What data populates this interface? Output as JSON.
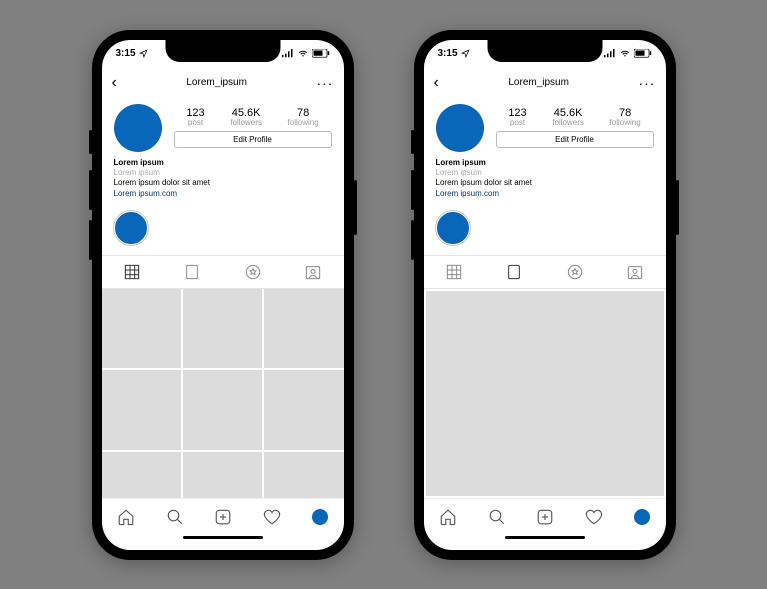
{
  "status": {
    "time": "3:15",
    "signal": "􀙇",
    "wifi": "􀙈",
    "battery": "􀛨"
  },
  "profile": {
    "username": "Lorem_ipsum",
    "stats": {
      "posts": {
        "value": "123",
        "label": "post"
      },
      "followers": {
        "value": "45.6K",
        "label": "followers"
      },
      "following": {
        "value": "78",
        "label": "following"
      }
    },
    "edit_label": "Edit Profile",
    "bio": {
      "name": "Lorem ipsum",
      "subtitle": "Lorem ipsum",
      "text": "Lorem ipsum dolor sit amet",
      "link": "Lorem ipsum.com"
    }
  }
}
